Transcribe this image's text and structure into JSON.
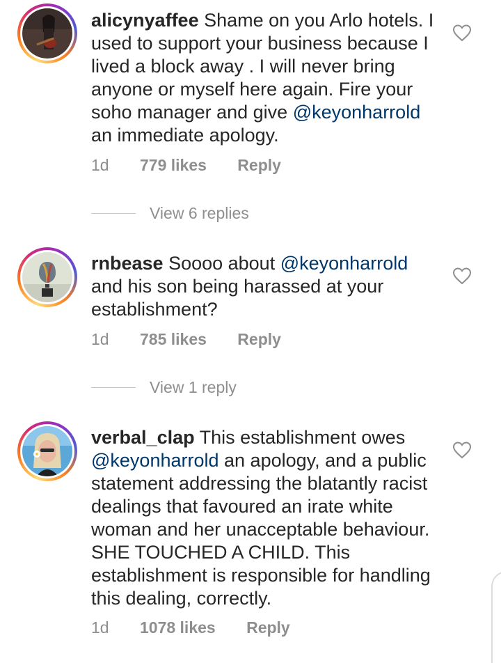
{
  "comments": [
    {
      "username": "alicynyaffee",
      "text_parts": [
        " Shame on you Arlo hotels. I used to support your business because I lived a block away . I will never bring anyone or myself here again. Fire your soho manager and give ",
        "@keyonharrold",
        " an immediate apology."
      ],
      "time": "1d",
      "likes": "779 likes",
      "reply_label": "Reply",
      "view_replies": "View 6 replies",
      "avatar_icon": "guitarist-avatar",
      "heart_icon": "heart-outline-icon"
    },
    {
      "username": "rnbease",
      "text_parts": [
        " Soooo about ",
        "@keyonharrold",
        " and his son being harassed at your establishment?"
      ],
      "time": "1d",
      "likes": "785 likes",
      "reply_label": "Reply",
      "view_replies": "View 1 reply",
      "avatar_icon": "hot-air-balloon-avatar",
      "heart_icon": "heart-outline-icon"
    },
    {
      "username": "verbal_clap",
      "text_parts": [
        " This establishment owes ",
        "@keyonharrold",
        " an apology, and a public statement addressing the blatantly racist dealings that favoured an irate white woman and her unacceptable behaviour. SHE TOUCHED A CHILD. This establishment is responsible for handling this dealing, correctly."
      ],
      "time": "1d",
      "likes": "1078 likes",
      "reply_label": "Reply",
      "avatar_icon": "woman-with-flower-avatar",
      "heart_icon": "heart-outline-icon"
    }
  ],
  "colors": {
    "text": "#262626",
    "secondary": "#8e8e8e",
    "mention": "#00376b"
  }
}
